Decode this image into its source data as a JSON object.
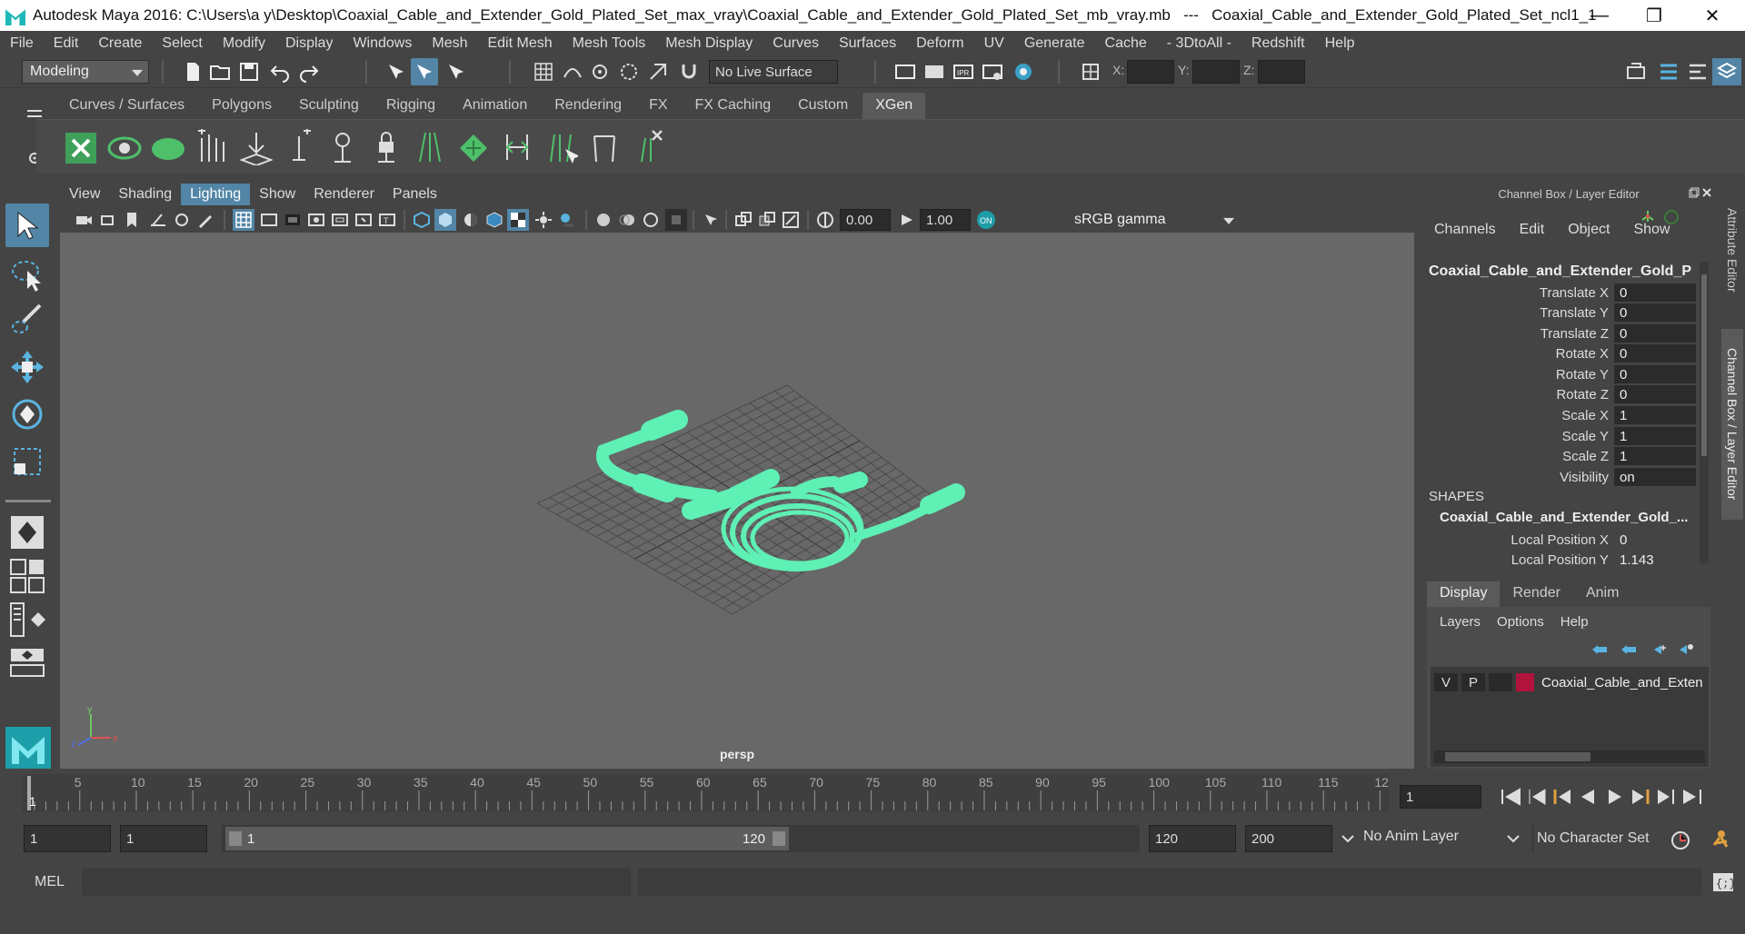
{
  "window": {
    "title": "Autodesk Maya 2016: C:\\Users\\a y\\Desktop\\Coaxial_Cable_and_Extender_Gold_Plated_Set_max_vray\\Coaxial_Cable_and_Extender_Gold_Plated_Set_mb_vray.mb   ---   Coaxial_Cable_and_Extender_Gold_Plated_Set_ncl1_1",
    "minimize": "—",
    "restore": "❐",
    "close": "✕"
  },
  "menubar": [
    "File",
    "Edit",
    "Create",
    "Select",
    "Modify",
    "Display",
    "Windows",
    "Mesh",
    "Edit Mesh",
    "Mesh Tools",
    "Mesh Display",
    "Curves",
    "Surfaces",
    "Deform",
    "UV",
    "Generate",
    "Cache",
    "- 3DtoAll -",
    "Redshift",
    "Help"
  ],
  "statusline": {
    "mode": "Modeling",
    "live_surface": "No Live Surface",
    "x_label": "X:",
    "y_label": "Y:",
    "z_label": "Z:"
  },
  "shelf": {
    "tabs": [
      "Curves / Surfaces",
      "Polygons",
      "Sculpting",
      "Rigging",
      "Animation",
      "Rendering",
      "FX",
      "FX Caching",
      "Custom",
      "XGen"
    ],
    "active_tab": "XGen"
  },
  "viewport": {
    "menus": [
      "View",
      "Shading",
      "Lighting",
      "Show",
      "Renderer",
      "Panels"
    ],
    "selected_menu": "Lighting",
    "exposure": "0.00",
    "gamma": "1.00",
    "color_space": "sRGB gamma",
    "camera": "persp",
    "mesh_color": "#5ef0b4",
    "grid_color": "#4a4a4a"
  },
  "channel_box": {
    "header": "Channel Box / Layer Editor",
    "menus": [
      "Channels",
      "Edit",
      "Object",
      "Show"
    ],
    "object_name": "Coaxial_Cable_and_Extender_Gold_Pl...",
    "channels": [
      {
        "label": "Translate X",
        "value": "0"
      },
      {
        "label": "Translate Y",
        "value": "0"
      },
      {
        "label": "Translate Z",
        "value": "0"
      },
      {
        "label": "Rotate X",
        "value": "0"
      },
      {
        "label": "Rotate Y",
        "value": "0"
      },
      {
        "label": "Rotate Z",
        "value": "0"
      },
      {
        "label": "Scale X",
        "value": "1"
      },
      {
        "label": "Scale Y",
        "value": "1"
      },
      {
        "label": "Scale Z",
        "value": "1"
      },
      {
        "label": "Visibility",
        "value": "on"
      }
    ],
    "shapes_header": "SHAPES",
    "shape_name": "Coaxial_Cable_and_Extender_Gold_...",
    "shape_channels": [
      {
        "label": "Local Position X",
        "value": "0"
      },
      {
        "label": "Local Position Y",
        "value": "1.143"
      }
    ]
  },
  "layer_editor": {
    "tabs": [
      "Display",
      "Render",
      "Anim"
    ],
    "active_tab": "Display",
    "menus": [
      "Layers",
      "Options",
      "Help"
    ],
    "layer": {
      "v": "V",
      "p": "P",
      "name": "Coaxial_Cable_and_Exten",
      "color": "#b0143c"
    }
  },
  "side_tabs": [
    "Attribute Editor",
    "Channel Box / Layer Editor"
  ],
  "timeline": {
    "ticks": [
      "5",
      "10",
      "15",
      "20",
      "25",
      "30",
      "35",
      "40",
      "45",
      "50",
      "55",
      "60",
      "65",
      "70",
      "75",
      "80",
      "85",
      "90",
      "95",
      "100",
      "105",
      "110",
      "115",
      "12"
    ],
    "current_frame_marker": "1",
    "current_frame": "1"
  },
  "range": {
    "start": "1",
    "playback_start": "1",
    "slider_start": "1",
    "slider_end": "120",
    "playback_end": "120",
    "end": "200",
    "anim_layer": "No Anim Layer",
    "character_set": "No Character Set"
  },
  "command": {
    "label": "MEL"
  }
}
